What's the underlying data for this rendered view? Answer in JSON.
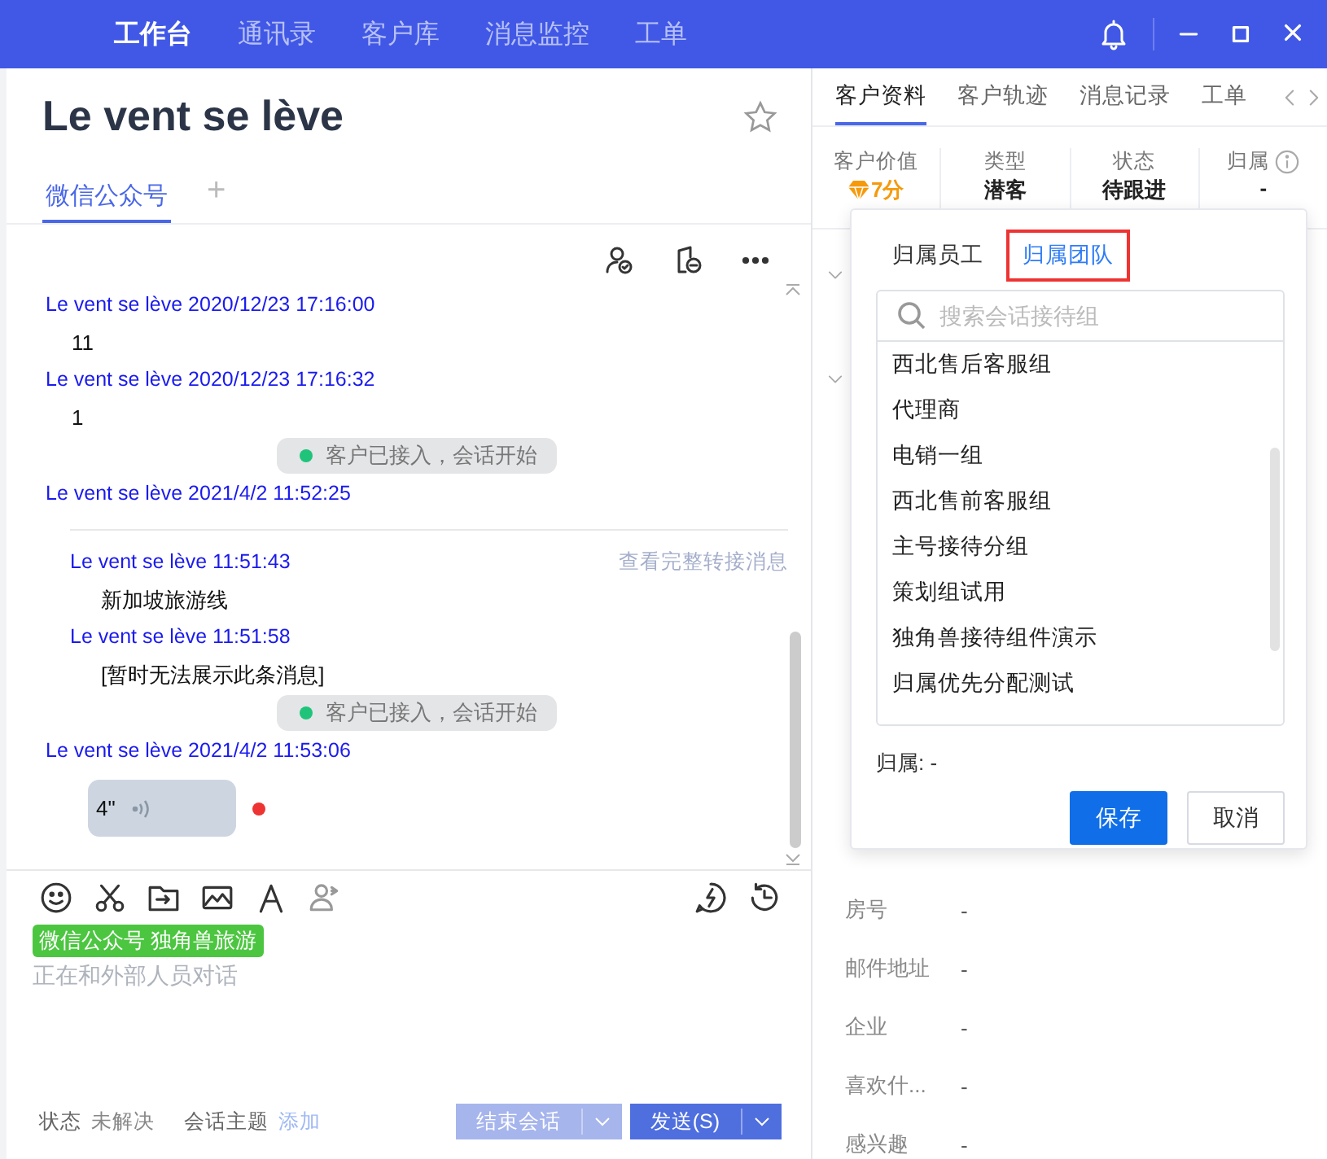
{
  "nav": {
    "items": [
      {
        "label": "工作台",
        "selected": true
      },
      {
        "label": "通讯录",
        "selected": false
      },
      {
        "label": "客户库",
        "selected": false
      },
      {
        "label": "消息监控",
        "selected": false
      },
      {
        "label": "工单",
        "selected": false
      }
    ]
  },
  "conversation": {
    "title": "Le vent se lève",
    "starred": false,
    "channel_tabs": [
      {
        "label": "微信公众号",
        "selected": true
      }
    ],
    "add_tab": "+"
  },
  "messages": [
    {
      "kind": "sender",
      "text": "Le vent se lève 2020/12/23 17:16:00"
    },
    {
      "kind": "text",
      "text": "11"
    },
    {
      "kind": "sender",
      "text": "Le vent se lève 2020/12/23 17:16:32"
    },
    {
      "kind": "text",
      "text": "1"
    },
    {
      "kind": "system",
      "text": "客户已接入，会话开始"
    },
    {
      "kind": "sender",
      "text": "Le vent se lève 2021/4/2 11:52:25"
    },
    {
      "kind": "transfer",
      "link": "查看完整转接消息",
      "messages": [
        {
          "kind": "sender",
          "text": "Le vent se lève 11:51:43"
        },
        {
          "kind": "text",
          "text": "新加坡旅游线"
        },
        {
          "kind": "sender",
          "text": "Le vent se lève 11:51:58"
        },
        {
          "kind": "text",
          "text": "[暂时无法展示此条消息]"
        }
      ]
    },
    {
      "kind": "system",
      "text": "客户已接入，会话开始"
    },
    {
      "kind": "sender",
      "text": "Le vent se lève 2021/4/2 11:53:06"
    },
    {
      "kind": "voice",
      "text": "4\"",
      "unread": true
    }
  ],
  "composer": {
    "tag": "微信公众号 独角兽旅游",
    "placeholder": "正在和外部人员对话",
    "status_label": "状态",
    "status": "未解决",
    "topic_label": "会话主题",
    "topic_action": "添加",
    "end_button": "结束会话",
    "send_button": "发送(S)"
  },
  "profile": {
    "tabs": [
      {
        "label": "客户资料",
        "selected": true
      },
      {
        "label": "客户轨迹",
        "selected": false
      },
      {
        "label": "消息记录",
        "selected": false
      },
      {
        "label": "工单",
        "selected": false
      }
    ],
    "stats": [
      {
        "kind": "score",
        "label": "客户价值",
        "value": "7分"
      },
      {
        "kind": "plain",
        "label": "类型",
        "value": "潜客"
      },
      {
        "kind": "plain",
        "label": "状态",
        "value": "待跟进"
      },
      {
        "kind": "info",
        "label": "归属",
        "value": "-"
      }
    ],
    "fields": [
      {
        "label": "房号",
        "value": "-"
      },
      {
        "label": "邮件地址",
        "value": "-"
      },
      {
        "label": "企业",
        "value": "-"
      },
      {
        "label": "喜欢什...",
        "value": "-"
      },
      {
        "label": "感兴趣",
        "value": "-"
      }
    ]
  },
  "owner_popup": {
    "tabs": [
      {
        "label": "归属员工",
        "selected": false,
        "highlighted": false
      },
      {
        "label": "归属团队",
        "selected": true,
        "highlighted": true
      }
    ],
    "search": {
      "placeholder": "搜索会话接待组"
    },
    "groups": [
      "西北售后客服组",
      "代理商",
      "电销一组",
      "西北售前客服组",
      "主号接待分组",
      "策划组试用",
      "独角兽接待组件演示",
      "归属优先分配测试"
    ],
    "owner": "归属: -",
    "save_button": "保存",
    "cancel_button": "取消"
  }
}
